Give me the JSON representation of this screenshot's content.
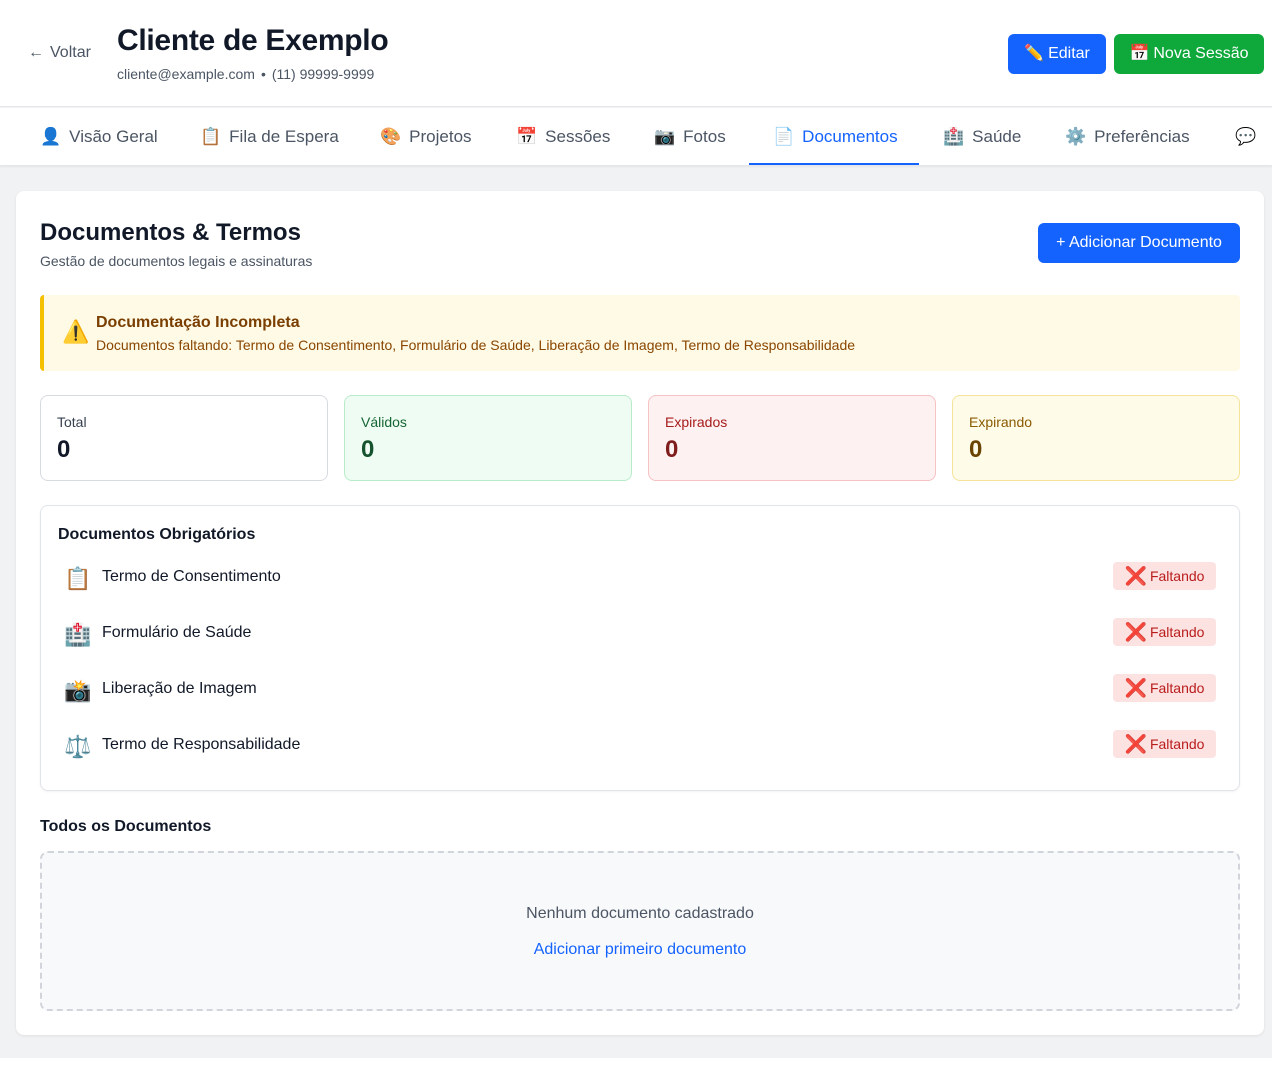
{
  "header": {
    "back_label": "Voltar",
    "back_icon": "arrow-left-icon",
    "client_name": "Cliente de Exemplo",
    "email": "cliente@example.com",
    "separator": "•",
    "phone": "(11) 99999-9999",
    "edit_icon": "✏️",
    "edit_label": "Editar",
    "session_icon": "📅",
    "session_label": "Nova Sessão"
  },
  "tabs": [
    {
      "icon": "👤",
      "label": "Visão Geral"
    },
    {
      "icon": "📋",
      "label": "Fila de Espera"
    },
    {
      "icon": "🎨",
      "label": "Projetos"
    },
    {
      "icon": "📅",
      "label": "Sessões"
    },
    {
      "icon": "📷",
      "label": "Fotos"
    },
    {
      "icon": "📄",
      "label": "Documentos",
      "active": true
    },
    {
      "icon": "🏥",
      "label": "Saúde"
    },
    {
      "icon": "⚙️",
      "label": "Preferências"
    },
    {
      "icon": "💬",
      "label": ""
    }
  ],
  "documents": {
    "title": "Documentos & Termos",
    "subtitle": "Gestão de documentos legais e assinaturas",
    "add_button": "+ Adicionar Documento",
    "alert": {
      "icon": "⚠️",
      "title": "Documentação Incompleta",
      "text": "Documentos faltando: Termo de Consentimento, Formulário de Saúde, Liberação de Imagem, Termo de Responsabilidade"
    },
    "stats": {
      "total": {
        "label": "Total",
        "value": "0"
      },
      "valid": {
        "label": "Válidos",
        "value": "0"
      },
      "expired": {
        "label": "Expirados",
        "value": "0"
      },
      "expiring": {
        "label": "Expirando",
        "value": "0"
      }
    },
    "required": {
      "title": "Documentos Obrigatórios",
      "items": [
        {
          "icon": "📋",
          "name": "Termo de Consentimento",
          "status_icon": "❌",
          "status": "Faltando"
        },
        {
          "icon": "🏥",
          "name": "Formulário de Saúde",
          "status_icon": "❌",
          "status": "Faltando"
        },
        {
          "icon": "📸",
          "name": "Liberação de Imagem",
          "status_icon": "❌",
          "status": "Faltando"
        },
        {
          "icon": "⚖️",
          "name": "Termo de Responsabilidade",
          "status_icon": "❌",
          "status": "Faltando"
        }
      ]
    },
    "all": {
      "title": "Todos os Documentos",
      "empty_text": "Nenhum documento cadastrado",
      "empty_link": "Adicionar primeiro documento"
    }
  },
  "colors": {
    "primary": "#1463ff",
    "success": "#0fa83a",
    "warning_border": "#f5c000",
    "danger_badge": "#fde2e2"
  }
}
